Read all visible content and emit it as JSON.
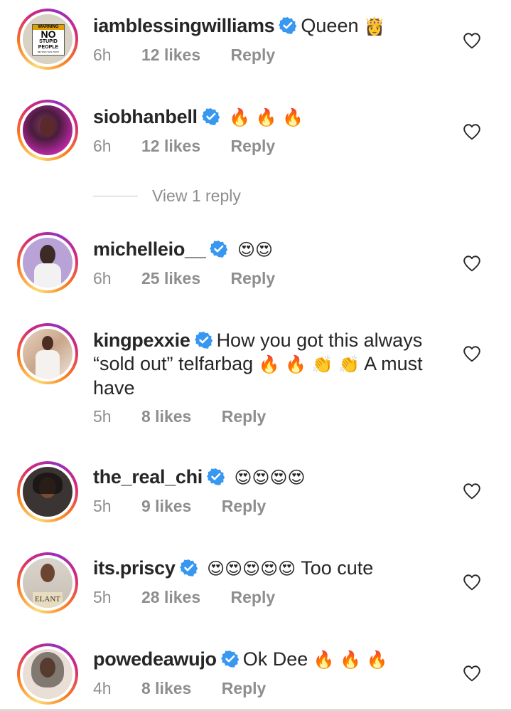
{
  "comments": [
    {
      "username": "iamblessingwilliams",
      "text": "Queen",
      "emoji": "👸",
      "time": "6h",
      "likes": "12 likes",
      "reply": "Reply"
    },
    {
      "username": "siobhanbell",
      "text": "",
      "emoji": "🔥 🔥 🔥",
      "time": "6h",
      "likes": "12 likes",
      "reply": "Reply"
    },
    {
      "username": "michelleio__",
      "text": "",
      "emoji": "😍😍",
      "time": "6h",
      "likes": "25 likes",
      "reply": "Reply"
    },
    {
      "username": "kingpexxie",
      "text": "How you got this always",
      "line2": "“sold out” telfarbag",
      "line2_emoji": "🔥 🔥  👏 👏",
      "line2_tail": "A must",
      "line3": "have",
      "time": "5h",
      "likes": "8 likes",
      "reply": "Reply"
    },
    {
      "username": "the_real_chi",
      "text": "",
      "emoji": "😍😍😍😍",
      "time": "5h",
      "likes": "9 likes",
      "reply": "Reply"
    },
    {
      "username": "its.priscy",
      "text": "",
      "emoji": "😍😍😍😍😍",
      "tail": "Too cute",
      "time": "5h",
      "likes": "28 likes",
      "reply": "Reply"
    },
    {
      "username": "powedeawujo",
      "text": "Ok Dee",
      "emoji": "🔥 🔥 🔥",
      "time": "4h",
      "likes": "8 likes",
      "reply": "Reply"
    }
  ],
  "view_replies": "View 1 reply",
  "avatar_sign": {
    "line1": "WARNING",
    "line2": "NO",
    "line3": "STUPID",
    "line4": "PEOPLE",
    "line5": "BEYOND THIS POINT"
  },
  "avatar_shirt_text": "ELANT",
  "colors": {
    "verified": "#3897f0",
    "meta": "#8e8e8e",
    "text": "#262626"
  },
  "icons": {
    "verified": "verified-badge-icon",
    "like": "heart-outline-icon"
  }
}
